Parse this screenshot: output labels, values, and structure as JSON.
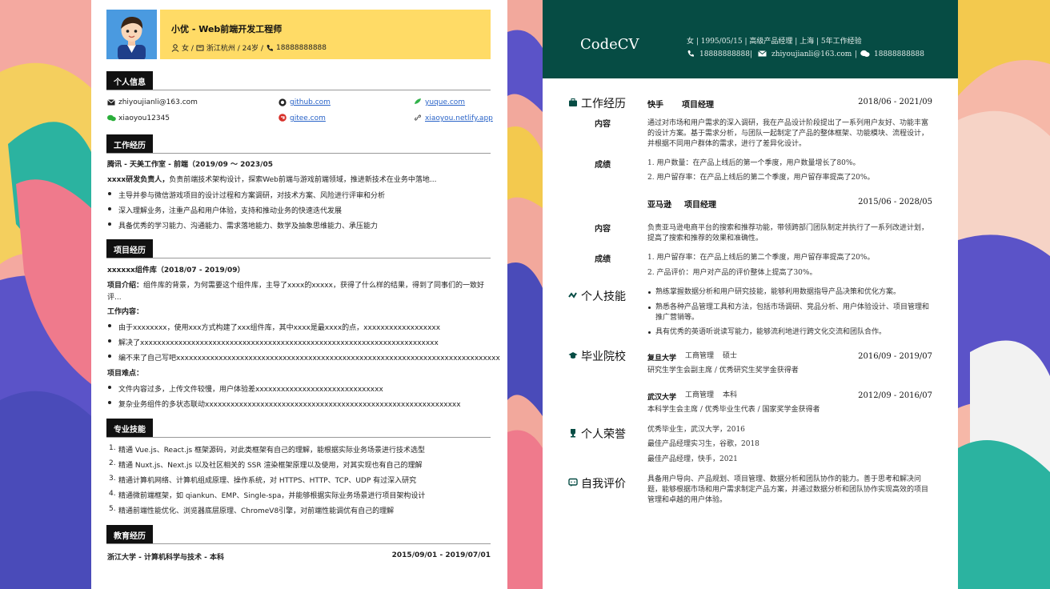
{
  "resume1": {
    "name": "小优 - Web前端开发工程师",
    "meta": [
      "女 / ",
      "浙江杭州 / 24岁 / ",
      "18888888888"
    ],
    "sections": [
      "个人信息",
      "工作经历",
      "项目经历",
      "专业技能",
      "教育经历"
    ],
    "contacts": {
      "email": "zhiyoujianli@163.com",
      "wechat": "xiaoyou12345",
      "github": "github.com",
      "gitee": "gitee.com",
      "yuque": "yuque.com",
      "site": "xiaoyou.netlify.app"
    },
    "work": {
      "title": "腾讯 - 天美工作室 - 前端（2019/09 ～ 2023/05",
      "intro_bold": "xxxx研发负责人，",
      "intro": "负责前端技术架构设计，探索Web前端与游戏前端领域，推进新技术在业务中落地...",
      "bullets": [
        "主导并参与微信游戏项目的设计过程和方案调研，对技术方案、风险进行评审和分析",
        "深入理解业务，注重产品和用户体验，支持和推动业务的快速迭代发展",
        "具备优秀的学习能力、沟通能力、需求落地能力、数学及抽象思维能力、承压能力"
      ]
    },
    "project": {
      "title": "xxxxxx组件库（2018/07 - 2019/09）",
      "intro_label": "项目介绍：",
      "intro1": "组件库的背景，为何需要这个组件库，主导了xxxx的xxxxx，获得了什么样的结果，得到了同事们的一致好",
      "intro2": "评...",
      "work_label": "工作内容：",
      "work": [
        "由于xxxxxxxx，使用xxx方式构建了xxx组件库，其中xxxx是最xxxx的点，xxxxxxxxxxxxxxxxxx",
        "解决了xxxxxxxxxxxxxxxxxxxxxxxxxxxxxxxxxxxxxxxxxxxxxxxxxxxxxxxxxxxxxxxxxxxxxx",
        "编不来了自己写吧xxxxxxxxxxxxxxxxxxxxxxxxxxxxxxxxxxxxxxxxxxxxxxxxxxxxxxxxxxxxxxxxxxxxxxxxxxxx"
      ],
      "diff_label": "项目难点：",
      "diff": [
        "文件内容过多，上传文件较慢，用户体验差xxxxxxxxxxxxxxxxxxxxxxxxxxxxxx",
        "复杂业务组件的多状态联动xxxxxxxxxxxxxxxxxxxxxxxxxxxxxxxxxxxxxxxxxxxxxxxxxxxxxxxxxxxx"
      ]
    },
    "skills": [
      "精通 Vue.js、React.js 框架源码，对此类框架有自己的理解，能根据实际业务场景进行技术选型",
      "精通 Nuxt.js、Next.js 以及社区相关的 SSR 渲染框架原理以及使用，对其实现也有自己的理解",
      "精通计算机网络、计算机组成原理、操作系统，对 HTTPS、HTTP、TCP、UDP 有过深入研究",
      "精通微前端框架，如 qiankun、EMP、Single-spa，并能够根据实际业务场景进行项目架构设计",
      "精通前端性能优化、浏览器底层原理、ChromeV8引擎，对前端性能调优有自己的理解"
    ],
    "edu": {
      "school": "浙江大学 - 计算机科学与技术 - 本科",
      "period": "2015/09/01 - 2019/07/01"
    }
  },
  "resume2": {
    "brand": "CodeCV",
    "line1": "女  |  1995/05/15  |  高级产品经理  |  上海 | 5年工作经验",
    "phone": "18888888888",
    "email": "zhiyoujianli@163.com",
    "wechat": "18888888888",
    "sections": [
      "工作经历",
      "个人技能",
      "毕业院校",
      "个人荣誉",
      "自我评价"
    ],
    "jobs": [
      {
        "company": "快手",
        "role": "项目经理",
        "period": "2018/06 - 2021/09",
        "content_label": "内容",
        "content": "通过对市场和用户需求的深入调研，我在产品设计阶段提出了一系列用户友好、功能丰富的设计方案。基于需求分析，与团队一起制定了产品的整体框架、功能模块、流程设计，并根据不同用户群体的需求，进行了差异化设计。",
        "result_label": "成绩",
        "results": [
          "1. 用户数量：在产品上线后的第一个季度，用户数量增长了80%。",
          "2. 用户留存率：在产品上线后的第二个季度，用户留存率提高了20%。"
        ]
      },
      {
        "company": "亚马逊",
        "role": "项目经理",
        "period": "2015/06 - 2028/05",
        "content_label": "内容",
        "content": "负责亚马逊电商平台的搜索和推荐功能，带领跨部门团队制定并执行了一系列改进计划，提高了搜索和推荐的效果和准确性。",
        "result_label": "成绩",
        "results": [
          "1. 用户留存率：在产品上线后的第二个季度，用户留存率提高了20%。",
          "2. 产品评价：用户对产品的评价整体上提高了30%。"
        ]
      }
    ],
    "skills": [
      "熟练掌握数据分析和用户研究技能，能够利用数据指导产品决策和优化方案。",
      "熟悉各种产品管理工具和方法，包括市场调研、竞品分析、用户体验设计、项目管理和推广营销等。",
      "具有优秀的英语听说读写能力，能够流利地进行跨文化交流和团队合作。"
    ],
    "schools": [
      {
        "name": "复旦大学",
        "major": "工商管理",
        "degree": "硕士",
        "period": "2016/09 - 2019/07",
        "note": "研究生学生会副主席 / 优秀研究生奖学金获得者"
      },
      {
        "name": "武汉大学",
        "major": "工商管理",
        "degree": "本科",
        "period": "2012/09 - 2016/07",
        "note": "本科学生会主席 / 优秀毕业生代表 / 国家奖学金获得者"
      }
    ],
    "honors": [
      "优秀毕业生，武汉大学，2016",
      "最佳产品经理实习生，谷歌，2018",
      "最佳产品经理，快手，2021"
    ],
    "self": "具备用户导向、产品规划、项目管理、数据分析和团队协作的能力。善于思考和解决问题，能够根据市场和用户需求制定产品方案，并通过数据分析和团队协作实现高效的项目管理和卓越的用户体验。"
  }
}
